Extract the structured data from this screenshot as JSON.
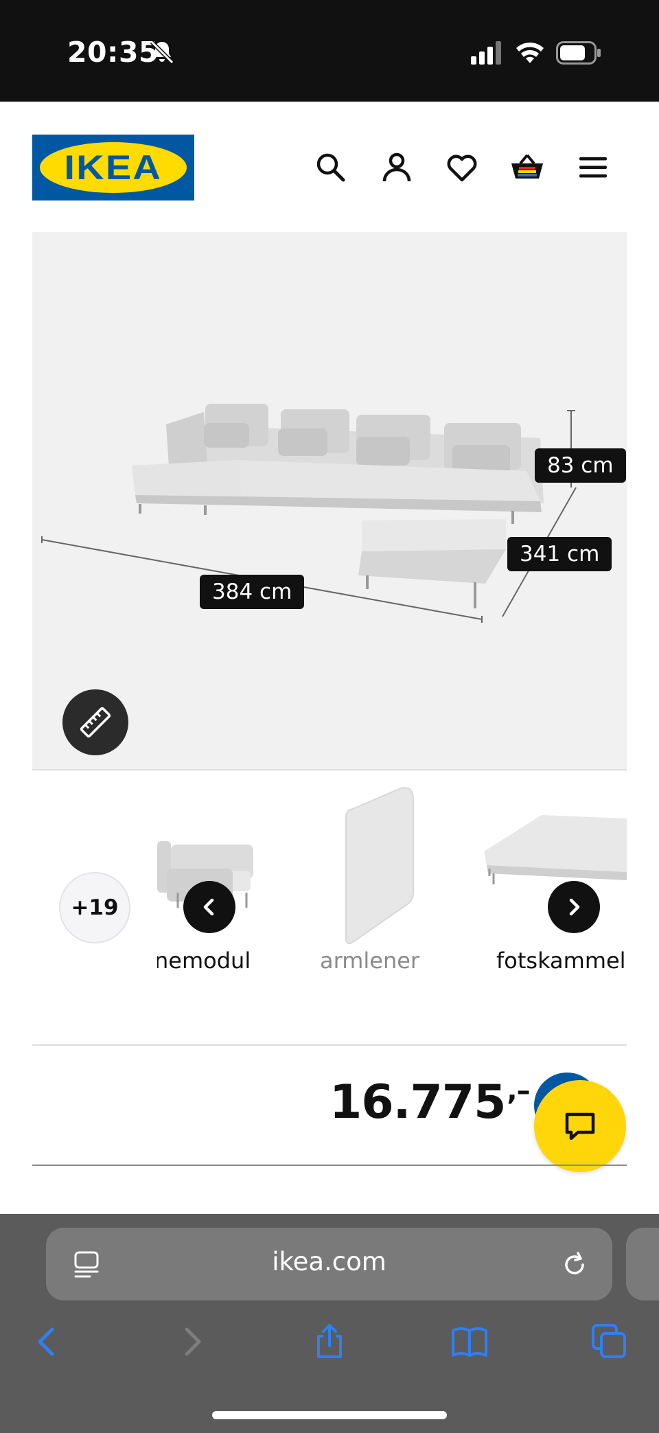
{
  "status_bar": {
    "time": "20:35",
    "icons": [
      "bell-slash-icon",
      "cellular-signal-icon",
      "wifi-icon",
      "battery-icon"
    ]
  },
  "header": {
    "logo_text": "IKEA",
    "icons": [
      "search-icon",
      "account-icon",
      "wishlist-heart-icon",
      "shopping-basket-icon",
      "menu-icon"
    ]
  },
  "hero": {
    "dimensions": {
      "height": "83 cm",
      "depth": "341 cm",
      "width": "384 cm"
    },
    "measure_button_icon": "ruler-icon"
  },
  "thumbnails": {
    "more_count": "+19",
    "items": [
      {
        "label": "nemodul"
      },
      {
        "label": "armlener"
      },
      {
        "label": "fotskammel"
      }
    ],
    "prev_icon": "chevron-left-icon",
    "next_icon": "chevron-right-icon"
  },
  "price": {
    "value": "16.775",
    "suffix": ",–"
  },
  "chat": {
    "icon": "chat-bubble-icon"
  },
  "browser": {
    "url": "ikea.com",
    "icons": [
      "page-menu-icon",
      "reload-icon",
      "back-icon",
      "forward-icon",
      "share-icon",
      "bookmarks-icon",
      "tabs-icon"
    ]
  },
  "colors": {
    "ikea_blue": "#0058a3",
    "ikea_yellow": "#ffdb00",
    "chat_yellow": "#ffd60a",
    "safari_blue": "#2f7ff5"
  }
}
